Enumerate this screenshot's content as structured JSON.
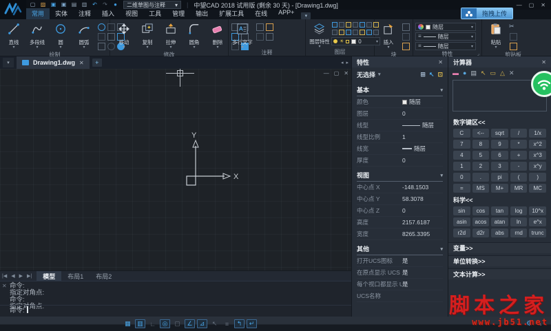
{
  "window": {
    "title": "中望CAD 2018 试用版 (剩余 30 天) - [Drawing1.dwg]",
    "workspace": "二维草图与注释",
    "upload_label": "拖拽上传"
  },
  "glyphs": {
    "dropdown": "▾",
    "close": "✕",
    "minimize": "—",
    "maximize": "▢",
    "plus": "+",
    "prev": "◀",
    "next": "▶",
    "first": "|◀",
    "last": "▶|",
    "back": "◂",
    "fwd": "▸",
    "gear": "⚙",
    "expand": "▴",
    "launcher": "⌟",
    "cut": "✂",
    "sun": "☀",
    "eq": "≡",
    "undo": "↶",
    "redo": "↷"
  },
  "qat_icons": [
    {
      "name": "new-file-icon",
      "glyph": "▢",
      "color": "#9fb3c8"
    },
    {
      "name": "open-folder-icon",
      "glyph": "▨",
      "color": "#d8a04e"
    },
    {
      "name": "save-icon",
      "glyph": "▣",
      "color": "#4aa6e8"
    },
    {
      "name": "save-all-icon",
      "glyph": "▣",
      "color": "#7fa8cc"
    },
    {
      "name": "print-icon",
      "glyph": "▤",
      "color": "#8fa0b2"
    },
    {
      "name": "preview-icon",
      "glyph": "▥",
      "color": "#8fa0b2"
    },
    {
      "name": "undo-icon",
      "glyph": "↶",
      "color": "#4aa6e8"
    },
    {
      "name": "redo-icon",
      "glyph": "↷",
      "color": "#5d6977"
    },
    {
      "name": "cloud-icon",
      "glyph": "●",
      "color": "#3e9adf"
    }
  ],
  "ribbon_tabs": [
    {
      "label": "常用",
      "active": true
    },
    {
      "label": "实体",
      "active": false
    },
    {
      "label": "注释",
      "active": false
    },
    {
      "label": "插入",
      "active": false
    },
    {
      "label": "视图",
      "active": false
    },
    {
      "label": "工具",
      "active": false
    },
    {
      "label": "管理",
      "active": false
    },
    {
      "label": "输出",
      "active": false
    },
    {
      "label": "扩展工具",
      "active": false
    },
    {
      "label": "在线",
      "active": false
    },
    {
      "label": "APP+",
      "active": false
    }
  ],
  "ribbon": {
    "layer_value": "0",
    "prop_values": {
      "color": "随层",
      "linetype": "随层",
      "lineweight": "随层"
    },
    "panels": [
      {
        "name": "draw",
        "label": "绘制",
        "big": [
          {
            "label": "直线",
            "icon": "line-icon"
          },
          {
            "label": "多段线",
            "icon": "polyline-icon"
          },
          {
            "label": "圆",
            "icon": "circle-icon"
          },
          {
            "label": "圆弧",
            "icon": "arc-icon"
          }
        ]
      },
      {
        "name": "modify",
        "label": "修改",
        "big": [
          {
            "label": "移动",
            "icon": "move-icon"
          },
          {
            "label": "复制",
            "icon": "copy-icon"
          },
          {
            "label": "拉伸",
            "icon": "stretch-icon"
          },
          {
            "label": "圆角",
            "icon": "fillet-icon"
          },
          {
            "label": "删除",
            "icon": "erase-icon"
          }
        ]
      },
      {
        "name": "annotate",
        "label": "注释",
        "big": [
          {
            "label": "多行文字",
            "icon": "mtext-icon"
          }
        ]
      },
      {
        "name": "layers",
        "label": "图层",
        "big": [
          {
            "label": "图层特性",
            "icon": "layer-props-icon"
          }
        ]
      },
      {
        "name": "block",
        "label": "块",
        "big": [
          {
            "label": "插入",
            "icon": "insert-icon"
          }
        ]
      },
      {
        "name": "properties",
        "label": "特性"
      },
      {
        "name": "clipboard",
        "label": "剪贴板",
        "big": [
          {
            "label": "粘贴",
            "icon": "paste-icon"
          }
        ]
      }
    ]
  },
  "docbar": {
    "tab": "Drawing1.dwg"
  },
  "props_panel": {
    "title": "特性",
    "selection": "无选择",
    "sel_icons": [
      {
        "name": "toggle-pickadd-icon",
        "glyph": "⊞",
        "color": "#9fb3c8"
      },
      {
        "name": "select-objects-icon",
        "glyph": "↖",
        "color": "#4aa6e8"
      },
      {
        "name": "quick-select-icon",
        "glyph": "⊡",
        "color": "#d8b64e"
      }
    ],
    "sections": [
      {
        "title": "基本",
        "rows": [
          {
            "label": "颜色",
            "value": "随层",
            "deco": "swatch"
          },
          {
            "label": "图层",
            "value": "0"
          },
          {
            "label": "线型",
            "value": "随层",
            "deco": "line"
          },
          {
            "label": "线型比例",
            "value": "1"
          },
          {
            "label": "线宽",
            "value": "随层",
            "deco": "thickline"
          },
          {
            "label": "厚度",
            "value": "0"
          }
        ]
      },
      {
        "title": "视图",
        "rows": [
          {
            "label": "中心点 X",
            "value": "-148.1503"
          },
          {
            "label": "中心点 Y",
            "value": "58.3078"
          },
          {
            "label": "中心点 Z",
            "value": "0"
          },
          {
            "label": "高度",
            "value": "2157.6187"
          },
          {
            "label": "宽度",
            "value": "8265.3395"
          }
        ]
      },
      {
        "title": "其他",
        "rows": [
          {
            "label": "打开UCS图标",
            "value": "是"
          },
          {
            "label": "在原点显示 UCS ...",
            "value": "是"
          },
          {
            "label": "每个视口都显示 U...",
            "value": "是"
          },
          {
            "label": "UCS名称",
            "value": ""
          }
        ]
      }
    ]
  },
  "calc_panel": {
    "title": "计算器",
    "toolbar_icons": [
      {
        "name": "clear-history-icon",
        "glyph": "▬",
        "color": "#e87fb0"
      },
      {
        "name": "history-icon",
        "glyph": "●",
        "color": "#58a6dd"
      },
      {
        "name": "paste-value-icon",
        "glyph": "▤",
        "color": "#b8c2cc"
      },
      {
        "name": "pick-point-icon",
        "glyph": "↖",
        "color": "#d8b64e"
      },
      {
        "name": "measure-distance-icon",
        "glyph": "▭",
        "color": "#d8b64e"
      },
      {
        "name": "measure-angle-icon",
        "glyph": "△",
        "color": "#d8b64e"
      },
      {
        "name": "clear-icon",
        "glyph": "✕",
        "color": "#9aa4b0"
      }
    ],
    "numpad_header": "数字键区<<",
    "numpad": [
      [
        "C",
        "<--",
        "sqrt",
        "/",
        "1/x"
      ],
      [
        "7",
        "8",
        "9",
        "*",
        "x^2"
      ],
      [
        "4",
        "5",
        "6",
        "+",
        "x^3"
      ],
      [
        "1",
        "2",
        "3",
        "-",
        "x^y"
      ],
      [
        "0",
        ".",
        "pi",
        "(",
        ")"
      ],
      [
        "=",
        "MS",
        "M+",
        "MR",
        "MC"
      ]
    ],
    "sci_header": "科学<<",
    "sci": [
      [
        "sin",
        "cos",
        "tan",
        "log",
        "10^x"
      ],
      [
        "asin",
        "acos",
        "atan",
        "ln",
        "e^x"
      ],
      [
        "r2d",
        "d2r",
        "abs",
        "rnd",
        "trunc"
      ]
    ],
    "collapsed": [
      "变量>>",
      "单位转换>>",
      "文本计算>>"
    ]
  },
  "model_tabs": [
    {
      "label": "模型",
      "active": true
    },
    {
      "label": "布局1",
      "active": false
    },
    {
      "label": "布局2",
      "active": false
    }
  ],
  "command": {
    "history": [
      "命令:",
      "指定对角点:",
      "命令:",
      "指定对角点:"
    ],
    "prompt": "命令:"
  },
  "canvas": {
    "ucs_x": "X",
    "ucs_y": "Y"
  },
  "statusbar": {
    "toggles": [
      {
        "name": "grid-toggle",
        "glyph": "▦",
        "style": "on"
      },
      {
        "name": "snap-toggle",
        "glyph": "▥",
        "style": "boxed"
      },
      {
        "name": "ortho-toggle",
        "glyph": "∟",
        "style": "off"
      },
      {
        "name": "osnap-toggle",
        "glyph": "◎",
        "style": "boxed"
      },
      {
        "name": "polar-toggle",
        "glyph": "▢",
        "style": "off"
      },
      {
        "name": "otrack-toggle",
        "glyph": "∠",
        "style": "boxed"
      },
      {
        "name": "dynamic-ucs-toggle",
        "glyph": "⊿",
        "style": "boxed"
      },
      {
        "name": "dynamic-input-toggle",
        "glyph": "↖",
        "style": "off"
      },
      {
        "name": "lineweight-toggle",
        "glyph": "≡",
        "style": "off"
      },
      {
        "name": "selection-cycling-toggle",
        "glyph": "↰",
        "style": "boxed"
      },
      {
        "name": "quick-properties-toggle",
        "glyph": "↵",
        "style": "boxed"
      }
    ]
  },
  "watermark": {
    "title": "脚本之家",
    "url": "www.jb51.net"
  }
}
